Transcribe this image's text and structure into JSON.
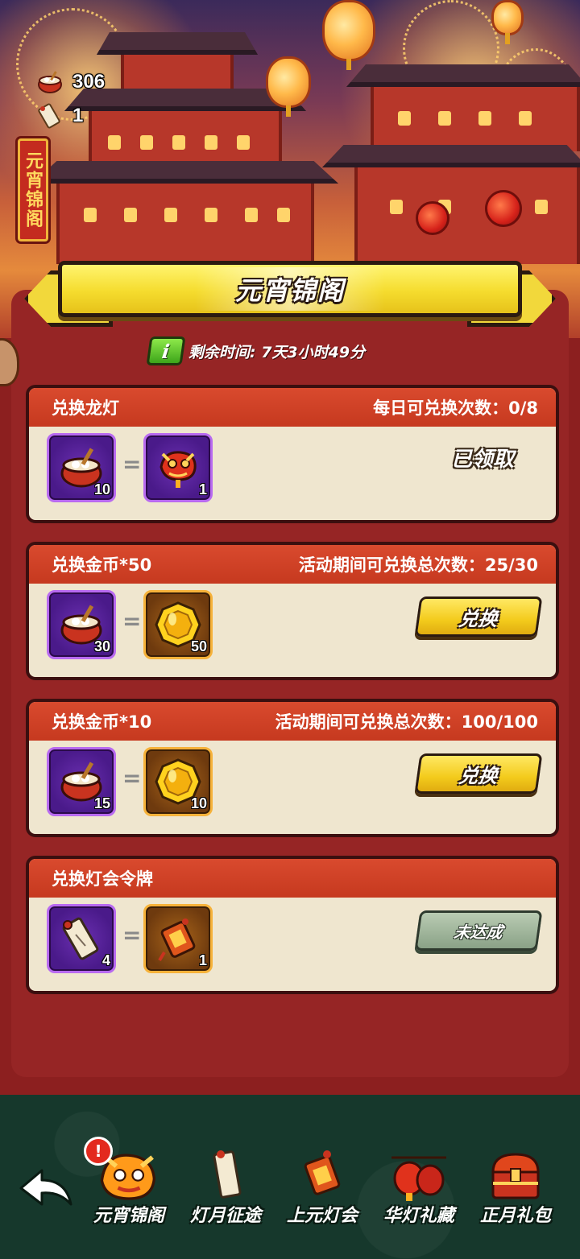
{
  "resources": [
    {
      "icon": "tangyuan-bowl-icon",
      "value": "306"
    },
    {
      "icon": "lantern-riddle-scroll-icon",
      "value": "1"
    }
  ],
  "side_sign": "元宵锦阁",
  "title": "元宵锦阁",
  "timer": {
    "info_label": "i",
    "text": "剩余时间: 7天3小时49分"
  },
  "exchanges": [
    {
      "name": "兑换龙灯",
      "limit": "每日可兑换次数：0/8",
      "cost": {
        "icon": "tangyuan-bowl-icon",
        "qty": "10"
      },
      "reward": {
        "icon": "dragon-lantern-icon",
        "qty": "1"
      },
      "action": {
        "type": "claimed",
        "label": "已领取"
      }
    },
    {
      "name": "兑换金币*50",
      "limit": "活动期间可兑换总次数：25/30",
      "cost": {
        "icon": "tangyuan-bowl-icon",
        "qty": "30"
      },
      "reward": {
        "icon": "gold-coin-icon",
        "qty": "50"
      },
      "action": {
        "type": "button",
        "label": "兑换"
      }
    },
    {
      "name": "兑换金币*10",
      "limit": "活动期间可兑换总次数：100/100",
      "cost": {
        "icon": "tangyuan-bowl-icon",
        "qty": "15"
      },
      "reward": {
        "icon": "gold-coin-icon",
        "qty": "10"
      },
      "action": {
        "type": "button",
        "label": "兑换"
      }
    },
    {
      "name": "兑换灯会令牌",
      "limit": "",
      "cost": {
        "icon": "lantern-riddle-scroll-icon",
        "qty": "4"
      },
      "reward": {
        "icon": "lantern-festival-token-icon",
        "qty": "1"
      },
      "action": {
        "type": "disabled",
        "label": "未达成"
      }
    }
  ],
  "equals_sign": "=",
  "nav": {
    "alert": "!",
    "tabs": [
      {
        "label": "元宵锦阁",
        "icon": "dragon-head-icon",
        "active": true
      },
      {
        "label": "灯月征途",
        "icon": "riddle-scroll-icon",
        "active": false
      },
      {
        "label": "上元灯会",
        "icon": "lantern-token-icon",
        "active": false
      },
      {
        "label": "华灯礼藏",
        "icon": "red-lanterns-icon",
        "active": false
      },
      {
        "label": "正月礼包",
        "icon": "treasure-chest-icon",
        "active": false
      }
    ]
  },
  "colors": {
    "panel_red": "#962525",
    "header_red": "#d94a2e",
    "card_cream": "#efe6cf",
    "button_yellow": "#f3cb1c",
    "nav_green": "#16382c"
  }
}
